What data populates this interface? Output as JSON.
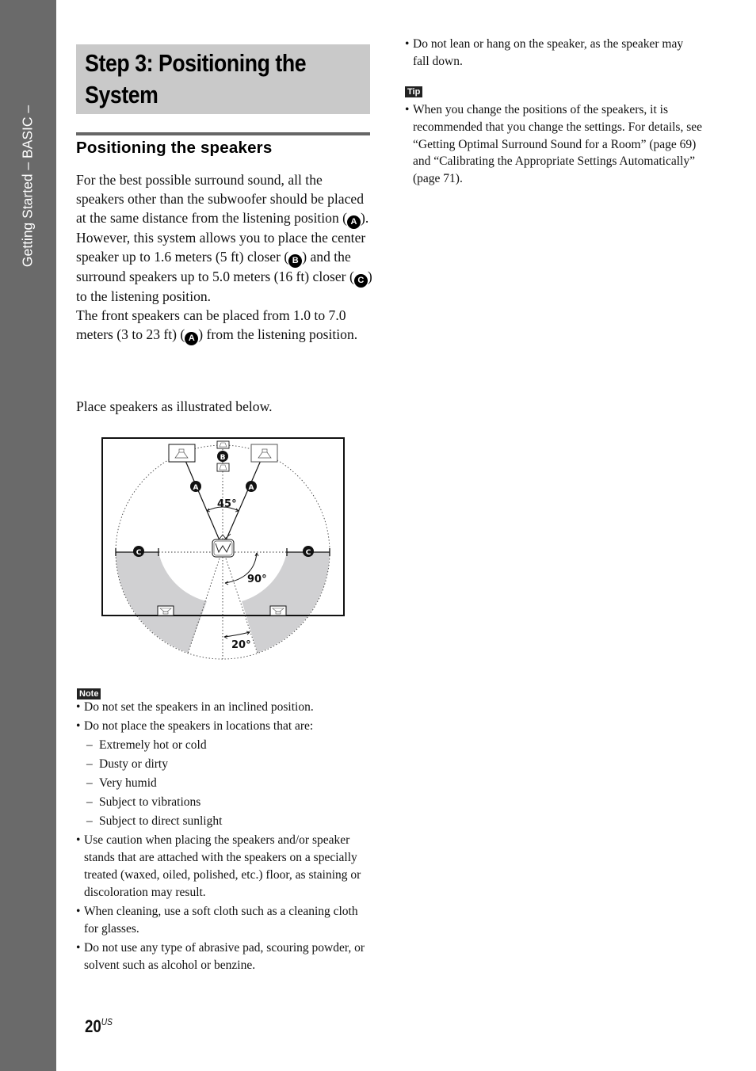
{
  "side_tab": {
    "label": "Getting Started – BASIC –"
  },
  "title": {
    "line1": "Step 3: Positioning the",
    "line2": "System"
  },
  "section_heading": "Positioning the speakers",
  "intro": {
    "p1_a": "For the best possible surround sound, all the speakers other than the subwoofer should be placed at the same distance from the listening position (",
    "p1_b": ").",
    "p2_a": "However, this system allows you to place the center speaker up to 1.6 meters (5 ft) closer (",
    "p2_b": ") and the surround speakers up to 5.0 meters (16 ft) closer (",
    "p2_c": ") to the listening position.",
    "p3_a": "The front speakers can be placed from 1.0 to 7.0 meters (3 to 23 ft) (",
    "p3_b": ") from the listening position.",
    "badges": {
      "a": "A",
      "b": "B",
      "c": "C"
    }
  },
  "place_text": "Place speakers as illustrated below.",
  "diagram": {
    "markers": {
      "a": "A",
      "b": "B",
      "c": "C"
    },
    "angles": {
      "front": "45°",
      "side": "90°",
      "rear": "20°"
    },
    "colors": {
      "shaded": "#d0d0d2",
      "line": "#222222"
    }
  },
  "note": {
    "label": "Note",
    "items": [
      "Do not set the speakers in an inclined position.",
      "Do not place the speakers in locations that are:"
    ],
    "sub_items": [
      "Extremely hot or cold",
      "Dusty or dirty",
      "Very humid",
      "Subject to vibrations",
      "Subject to direct sunlight"
    ],
    "items_after": [
      "Use caution when placing the speakers and/or speaker stands that are attached with the speakers on a specially treated (waxed, oiled, polished, etc.) floor, as staining or discoloration may result.",
      "When cleaning, use a soft cloth such as a cleaning cloth for glasses.",
      "Do not use any type of abrasive pad, scouring powder, or solvent such as alcohol or benzine."
    ]
  },
  "right_column": {
    "note_continued": "Do not lean or hang on the speaker, as the speaker may fall down.",
    "tip_label": "Tip",
    "tip_text": "When you change the positions of the speakers, it is recommended that you change the settings. For details, see “Getting Optimal Surround Sound for a Room” (page 69) and “Calibrating the Appropriate Settings Automatically” (page 71)."
  },
  "page": {
    "number": "20",
    "suffix": "US"
  }
}
